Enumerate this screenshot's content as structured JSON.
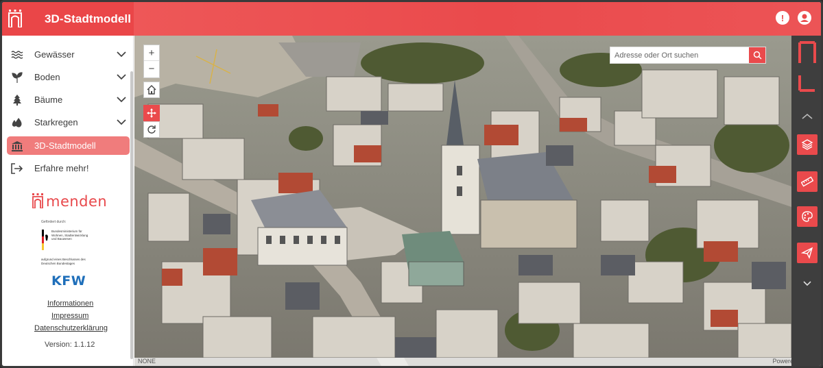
{
  "header": {
    "title": "3D-Stadtmodell",
    "brand_color": "#ea4a4c",
    "alert_icon": "exclamation-circle-icon",
    "user_icon": "user-circle-icon"
  },
  "sidebar": {
    "items": [
      {
        "label": "Gewässer",
        "icon": "waves-icon",
        "expandable": true
      },
      {
        "label": "Boden",
        "icon": "seedling-icon",
        "expandable": true
      },
      {
        "label": "Bäume",
        "icon": "tree-icon",
        "expandable": true
      },
      {
        "label": "Starkregen",
        "icon": "water-drops-icon",
        "expandable": true
      },
      {
        "label": "3D-Stadtmodell",
        "icon": "city-building-icon",
        "active": true
      },
      {
        "label": "Erfahre mehr!",
        "icon": "sign-out-icon"
      }
    ],
    "logo_text": "menden",
    "funding_label": "Gefördert durch:",
    "ministry_text": "Bundesministerium für Wohnen, Stadtentwicklung und Bauwesen",
    "decision_text": "aufgrund eines Beschlusses des Deutschen Bundestages",
    "kfw_text": "KFW",
    "links": {
      "info": "Informationen",
      "impressum": "Impressum",
      "privacy": "Datenschutzerklärung"
    },
    "version": "Version: 1.1.12"
  },
  "map": {
    "zoom_in": "+",
    "zoom_out": "−",
    "search_placeholder": "Adresse oder Ort suchen",
    "attribution_left": "NONE",
    "attribution_right": "Powered by Esri"
  },
  "toolbar": {
    "tools": [
      "layers-icon",
      "ruler-icon",
      "palette-icon",
      "paper-plane-icon",
      "chevron-down-icon"
    ]
  }
}
